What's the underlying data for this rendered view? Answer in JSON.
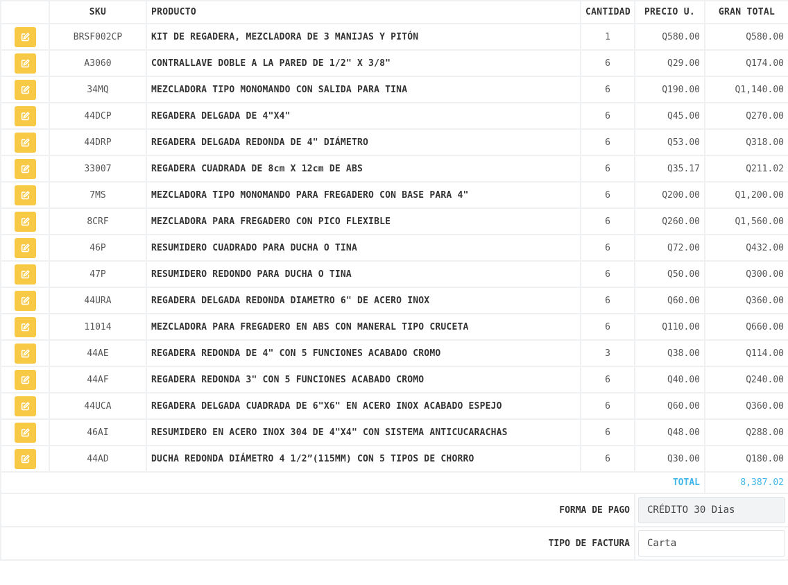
{
  "headers": {
    "edit": "",
    "sku": "SKU",
    "product": "PRODUCTO",
    "qty": "CANTIDAD",
    "price": "PRECIO U.",
    "total": "GRAN TOTAL"
  },
  "rows": [
    {
      "sku": "BRSF002CP",
      "product": "KIT DE REGADERA, MEZCLADORA DE 3 MANIJAS Y PITÓN",
      "qty": "1",
      "price": "Q580.00",
      "total": "Q580.00"
    },
    {
      "sku": "A3060",
      "product": "CONTRALLAVE DOBLE A LA PARED DE 1/2\" X 3/8\"",
      "qty": "6",
      "price": "Q29.00",
      "total": "Q174.00"
    },
    {
      "sku": "34MQ",
      "product": "MEZCLADORA TIPO MONOMANDO CON SALIDA PARA TINA",
      "qty": "6",
      "price": "Q190.00",
      "total": "Q1,140.00"
    },
    {
      "sku": "44DCP",
      "product": "REGADERA DELGADA DE 4\"X4\"",
      "qty": "6",
      "price": "Q45.00",
      "total": "Q270.00"
    },
    {
      "sku": "44DRP",
      "product": "REGADERA DELGADA REDONDA DE 4\" DIÁMETRO",
      "qty": "6",
      "price": "Q53.00",
      "total": "Q318.00"
    },
    {
      "sku": "33007",
      "product": "REGADERA CUADRADA DE 8cm X 12cm DE ABS",
      "qty": "6",
      "price": "Q35.17",
      "total": "Q211.02"
    },
    {
      "sku": "7MS",
      "product": "MEZCLADORA TIPO MONOMANDO PARA FREGADERO CON BASE PARA 4\"",
      "qty": "6",
      "price": "Q200.00",
      "total": "Q1,200.00"
    },
    {
      "sku": "8CRF",
      "product": "MEZCLADORA PARA FREGADERO CON PICO FLEXIBLE",
      "qty": "6",
      "price": "Q260.00",
      "total": "Q1,560.00"
    },
    {
      "sku": "46P",
      "product": "RESUMIDERO CUADRADO PARA DUCHA O TINA",
      "qty": "6",
      "price": "Q72.00",
      "total": "Q432.00"
    },
    {
      "sku": "47P",
      "product": "RESUMIDERO REDONDO PARA DUCHA O TINA",
      "qty": "6",
      "price": "Q50.00",
      "total": "Q300.00"
    },
    {
      "sku": "44URA",
      "product": "REGADERA DELGADA REDONDA DIAMETRO 6\" DE ACERO INOX",
      "qty": "6",
      "price": "Q60.00",
      "total": "Q360.00"
    },
    {
      "sku": "11014",
      "product": "MEZCLADORA PARA FREGADERO EN ABS CON MANERAL TIPO CRUCETA",
      "qty": "6",
      "price": "Q110.00",
      "total": "Q660.00"
    },
    {
      "sku": "44AE",
      "product": "REGADERA REDONDA DE 4\" CON 5 FUNCIONES ACABADO CROMO",
      "qty": "3",
      "price": "Q38.00",
      "total": "Q114.00"
    },
    {
      "sku": "44AF",
      "product": "REGADERA REDONDA 3\" CON 5 FUNCIONES ACABADO CROMO",
      "qty": "6",
      "price": "Q40.00",
      "total": "Q240.00"
    },
    {
      "sku": "44UCA",
      "product": "REGADERA DELGADA CUADRADA DE 6\"X6\" EN ACERO INOX ACABADO ESPEJO",
      "qty": "6",
      "price": "Q60.00",
      "total": "Q360.00"
    },
    {
      "sku": "46AI",
      "product": "RESUMIDERO EN ACERO INOX 304 DE 4\"X4\" CON SISTEMA ANTICUCARACHAS",
      "qty": "6",
      "price": "Q48.00",
      "total": "Q288.00"
    },
    {
      "sku": "44AD",
      "product": "DUCHA REDONDA DIÁMETRO 4 1/2”(115MM) CON 5 TIPOS DE CHORRO",
      "qty": "6",
      "price": "Q30.00",
      "total": "Q180.00"
    }
  ],
  "icons": {
    "edit": "edit-pencil-square-icon"
  },
  "totals": {
    "label": "TOTAL",
    "value": "8,387.02"
  },
  "payment": {
    "label": "FORMA DE PAGO",
    "value": "CRÉDITO 30 Dias"
  },
  "invoice": {
    "label": "TIPO DE FACTURA",
    "value": "Carta"
  },
  "colors": {
    "edit_button": "#f7c945",
    "total_accent": "#3fb6ea",
    "border": "#eef0f2"
  }
}
